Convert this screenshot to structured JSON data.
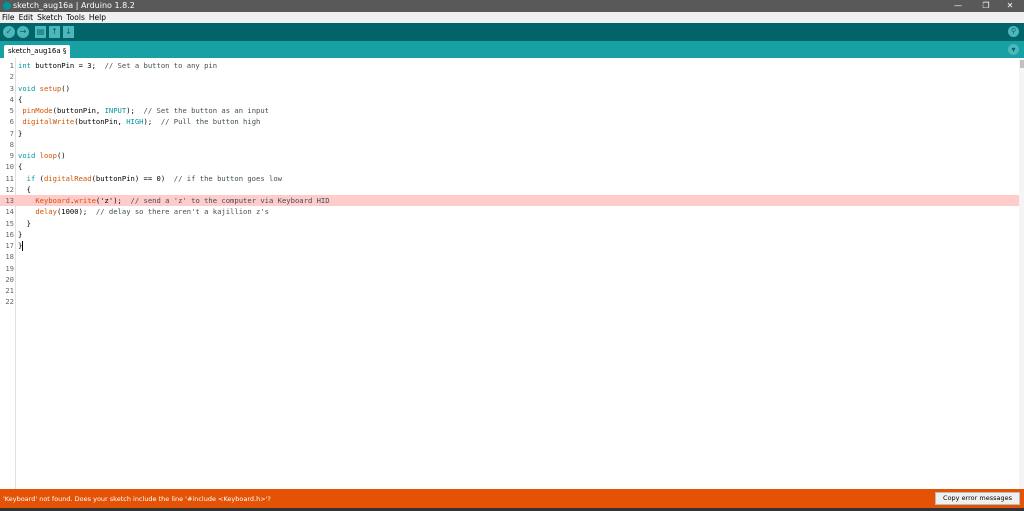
{
  "window": {
    "title": "sketch_aug16a | Arduino 1.8.2",
    "minimize_glyph": "—",
    "maximize_glyph": "❐",
    "close_glyph": "✕"
  },
  "menu": [
    "File",
    "Edit",
    "Sketch",
    "Tools",
    "Help"
  ],
  "toolbar": {
    "verify_glyph": "✓",
    "upload_glyph": "→",
    "new_glyph": "▤",
    "open_glyph": "↑",
    "save_glyph": "↓",
    "serial_glyph": "⚲"
  },
  "tabs": [
    {
      "label": "sketch_aug16a §"
    }
  ],
  "tab_menu_glyph": "▾",
  "editor": {
    "error_line": 13,
    "caret_line": 17,
    "lines": [
      {
        "n": "1",
        "code": "int buttonPin = 3;  // Set a button to any pin"
      },
      {
        "n": "2",
        "code": ""
      },
      {
        "n": "3",
        "code": "void setup()"
      },
      {
        "n": "4",
        "code": "{"
      },
      {
        "n": "5",
        "code": " pinMode(buttonPin, INPUT);  // Set the button as an input"
      },
      {
        "n": "6",
        "code": " digitalWrite(buttonPin, HIGH);  // Pull the button high"
      },
      {
        "n": "7",
        "code": "}"
      },
      {
        "n": "8",
        "code": ""
      },
      {
        "n": "9",
        "code": "void loop()"
      },
      {
        "n": "10",
        "code": "{"
      },
      {
        "n": "11",
        "code": "  if (digitalRead(buttonPin) == 0)  // if the button goes low"
      },
      {
        "n": "12",
        "code": "  {"
      },
      {
        "n": "13",
        "code": "    Keyboard.write('z');  // send a 'z' to the computer via Keyboard HID"
      },
      {
        "n": "14",
        "code": "    delay(1000);  // delay so there aren't a kajillion z's"
      },
      {
        "n": "15",
        "code": "  }"
      },
      {
        "n": "16",
        "code": "}"
      },
      {
        "n": "17",
        "code": "}"
      },
      {
        "n": "18",
        "code": ""
      },
      {
        "n": "19",
        "code": ""
      },
      {
        "n": "20",
        "code": ""
      },
      {
        "n": "21",
        "code": ""
      },
      {
        "n": "22",
        "code": ""
      }
    ]
  },
  "status": {
    "message": "'Keyboard' not found. Does your sketch include the line '#include <Keyboard.h>'?",
    "copy_button": "Copy error messages"
  },
  "colors": {
    "toolbar": "#006468",
    "tabbar": "#17a1a5",
    "error_bar": "#e35205",
    "error_line": "#ffcccc"
  }
}
